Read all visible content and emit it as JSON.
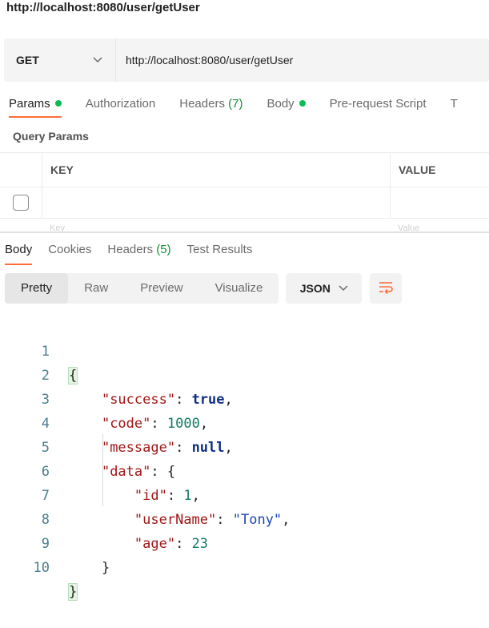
{
  "window": {
    "title": "http://localhost:8080/user/getUser"
  },
  "request": {
    "method": "GET",
    "url": "http://localhost:8080/user/getUser"
  },
  "request_tabs": [
    {
      "label": "Params",
      "dot": true,
      "active": true
    },
    {
      "label": "Authorization"
    },
    {
      "label": "Headers",
      "count": "(7)"
    },
    {
      "label": "Body",
      "dot": true
    },
    {
      "label": "Pre-request Script"
    },
    {
      "label": "T"
    }
  ],
  "query_params": {
    "title": "Query Params",
    "headers": {
      "key": "KEY",
      "value": "VALUE"
    },
    "placeholder_row": {
      "key": "Key",
      "value": "Value"
    }
  },
  "response_tabs": [
    {
      "label": "Body",
      "active": true
    },
    {
      "label": "Cookies"
    },
    {
      "label": "Headers",
      "count": "(5)"
    },
    {
      "label": "Test Results"
    }
  ],
  "view_modes": [
    "Pretty",
    "Raw",
    "Preview",
    "Visualize"
  ],
  "active_view": "Pretty",
  "format": "JSON",
  "colors": {
    "accent": "#ff6c37",
    "dot": "#0cbb52",
    "count": "#0e8f33"
  },
  "response_body": {
    "success": "true",
    "code": "1000",
    "message": "null",
    "data": {
      "id": "1",
      "userName": "\"Tony\"",
      "age": "23"
    }
  },
  "line_numbers": [
    "1",
    "2",
    "3",
    "4",
    "5",
    "6",
    "7",
    "8",
    "9",
    "10"
  ]
}
